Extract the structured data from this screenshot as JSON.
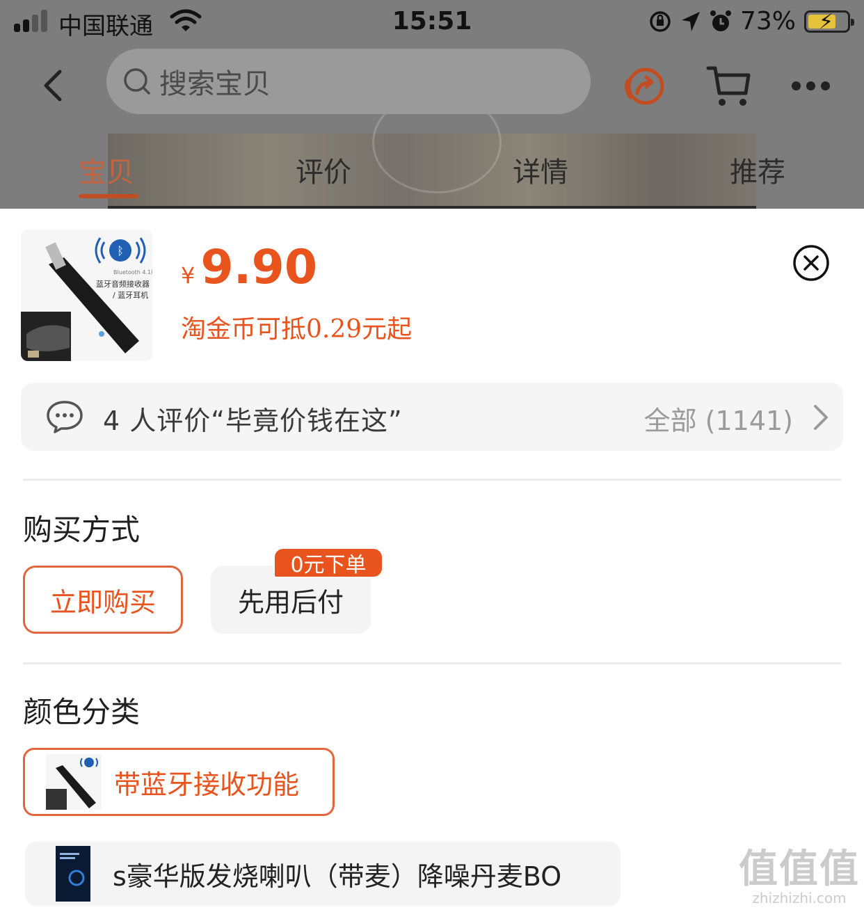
{
  "status_bar": {
    "carrier": "中国联通",
    "time": "15:51",
    "battery_percent": "73%"
  },
  "header": {
    "search_placeholder": "搜索宝贝",
    "back_icon": "chevron-left-icon",
    "share_icon": "share-icon",
    "cart_icon": "cart-icon",
    "more_icon": "more-icon"
  },
  "tabs": [
    {
      "label": "宝贝",
      "active": true
    },
    {
      "label": "评价",
      "active": false
    },
    {
      "label": "详情",
      "active": false
    },
    {
      "label": "推荐",
      "active": false
    }
  ],
  "product": {
    "thumb_text_1": "Bluetooth 4.1版本",
    "thumb_text_2": "蓝牙音频接收器",
    "thumb_text_3": "/ 蓝牙耳机",
    "currency_symbol": "¥",
    "price": "9.90",
    "coin_offer": "淘金币可抵0.29元起"
  },
  "reviews": {
    "summary": "4 人评价“毕竟价钱在这”",
    "all_label": "全部 (1141)"
  },
  "purchase_method": {
    "title": "购买方式",
    "options": [
      {
        "label": "立即购买",
        "selected": true
      },
      {
        "label": "先用后付",
        "selected": false
      }
    ],
    "badge": "0元下单"
  },
  "color_category": {
    "title": "颜色分类",
    "options": [
      {
        "label": "带蓝牙接收功能",
        "selected": true
      },
      {
        "label": "s豪华版发烧喇叭（带麦）降噪丹麦BO",
        "selected": false
      }
    ]
  },
  "watermark": {
    "logo": "值值值",
    "domain": "zhizhizhi.com"
  },
  "colors": {
    "accent": "#e8531e",
    "accent_border": "#e0663e",
    "overlay": "#7d7d7d"
  }
}
